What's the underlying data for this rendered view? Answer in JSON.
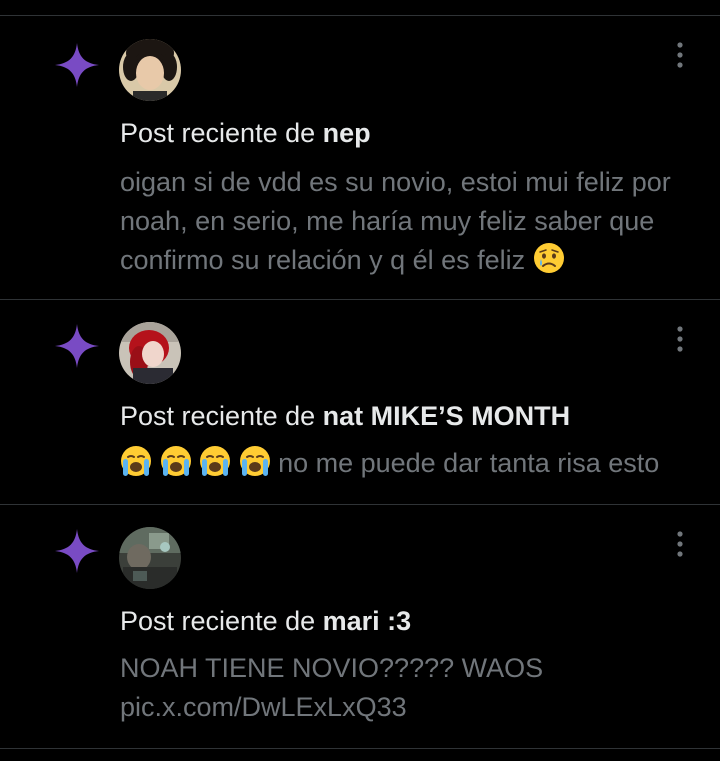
{
  "colors": {
    "background": "#000000",
    "accent_sparkle": "#794bc4",
    "title_text": "#e7e9ea",
    "body_text": "#71767b",
    "divider": "#2f3336"
  },
  "notifications": [
    {
      "icon": "sparkle-icon",
      "avatar": "user-avatar",
      "prefix": "Post reciente de ",
      "user": "nep",
      "text": "oigan si de vdd es su novio, estoi mui feliz por noah, en serio, me haría muy feliz saber que confirmo su relación y q él es feliz",
      "emoji_after": "crying-face-emoji"
    },
    {
      "icon": "sparkle-icon",
      "avatar": "user-avatar",
      "prefix": "Post reciente de ",
      "user": "nat MIKE’S MONTH",
      "emoji_before": [
        "loudly-crying-face-emoji",
        "loudly-crying-face-emoji",
        "loudly-crying-face-emoji",
        "loudly-crying-face-emoji"
      ],
      "text": "no me puede dar tanta risa esto"
    },
    {
      "icon": "sparkle-icon",
      "avatar": "user-avatar",
      "prefix": "Post reciente de ",
      "user": "mari :3",
      "text": "NOAH TIENE NOVIO????? WAOS",
      "link": "pic.x.com/DwLExLxQ33"
    }
  ]
}
